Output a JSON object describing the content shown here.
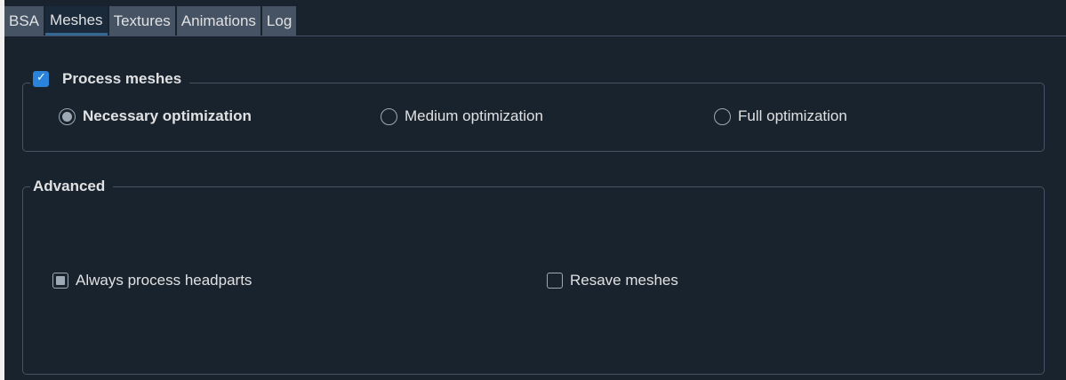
{
  "tabs": [
    {
      "label": "BSA",
      "active": false
    },
    {
      "label": "Meshes",
      "active": true
    },
    {
      "label": "Textures",
      "active": false
    },
    {
      "label": "Animations",
      "active": false
    },
    {
      "label": "Log",
      "active": false
    }
  ],
  "process_group": {
    "title": "Process meshes",
    "checked": true,
    "options": [
      {
        "label": "Necessary optimization",
        "selected": true
      },
      {
        "label": "Medium optimization",
        "selected": false
      },
      {
        "label": "Full optimization",
        "selected": false
      }
    ]
  },
  "advanced_group": {
    "title": "Advanced",
    "always_process_headparts": {
      "label": "Always process headparts",
      "state": "partially-checked"
    },
    "resave_meshes": {
      "label": "Resave meshes",
      "state": "unchecked"
    }
  },
  "colors": {
    "background": "#19232d",
    "tab": "#455364",
    "accent": "#346792",
    "checkbox_checked": "#2a82da"
  }
}
